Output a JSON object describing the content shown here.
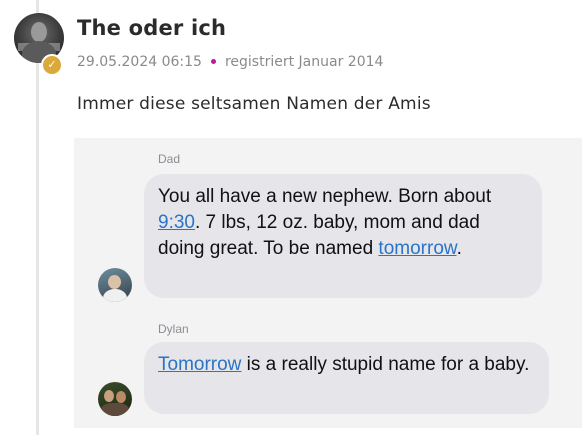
{
  "post": {
    "author": "The oder ich",
    "date": "29.05.2024 06:15",
    "registered": "registriert Januar 2014",
    "text": "Immer diese seltsamen Namen der Amis",
    "icons": {
      "avatar": "user-avatar-icon",
      "badge": "verified-check-icon",
      "separator": "dot-separator-icon"
    },
    "colors": {
      "badge": "#d9a93a",
      "separator_dot": "#c2189a",
      "meta_text": "#8a8a8a"
    }
  },
  "conversation": {
    "messages": [
      {
        "sender": "Dad",
        "parts": [
          "You all have a new nephew. Born about ",
          "9:30",
          ". 7 lbs, 12 oz. baby, mom and dad doing great. To be named ",
          "tomorrow",
          "."
        ]
      },
      {
        "sender": "Dylan",
        "parts": [
          "Tomorrow",
          " is a really stupid name for a baby."
        ]
      }
    ],
    "colors": {
      "bubble": "#e5e5ea",
      "link": "#2a74c7",
      "background": "#f3f3f4"
    }
  }
}
